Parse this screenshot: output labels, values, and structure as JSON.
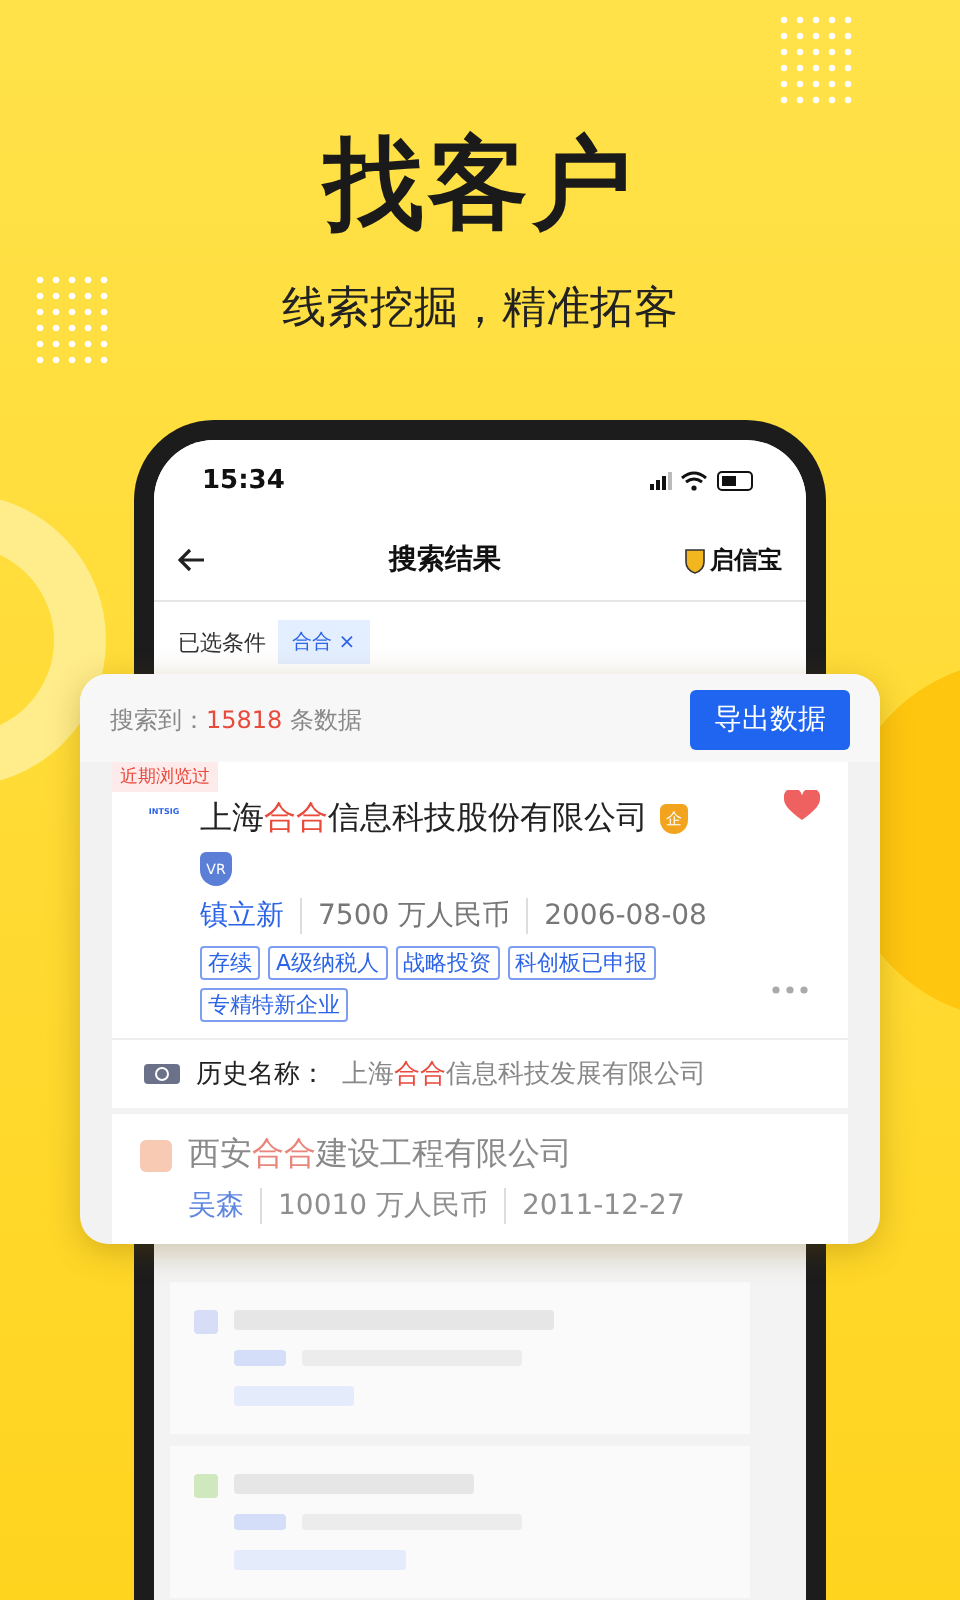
{
  "headline": "找客户",
  "subtitle": "线索挖掘，精准拓客",
  "status_bar": {
    "time": "15:34"
  },
  "nav": {
    "title": "搜索结果",
    "brand": "启信宝"
  },
  "filters": {
    "label": "已选条件",
    "chips": [
      {
        "text": "合合",
        "close": "×"
      }
    ]
  },
  "results": {
    "prefix": "搜索到：",
    "count": "15818",
    "suffix": "条数据",
    "export_button": "导出数据"
  },
  "featured": {
    "badge": "近期浏览过",
    "logo": "INTSIG",
    "name": [
      {
        "text": "上海",
        "hit": false
      },
      {
        "text": "合合",
        "hit": true
      },
      {
        "text": "信息科技股份有限公司",
        "hit": false
      }
    ],
    "enterprise_badge": "企",
    "vr_badge": "VR",
    "favorited": true,
    "person": "镇立新",
    "capital": "7500 万人民币",
    "date": "2006-08-08",
    "tags": [
      "存续",
      "A级纳税人",
      "战略投资",
      "科创板已申报",
      "专精特新企业"
    ],
    "history_label": "历史名称：",
    "history_name": [
      {
        "text": "上海",
        "hit": false
      },
      {
        "text": "合合",
        "hit": true
      },
      {
        "text": "信息科技发展有限公司",
        "hit": false
      }
    ]
  },
  "companies": [
    {
      "name": [
        {
          "text": "西安",
          "hit": false
        },
        {
          "text": "合合",
          "hit": true
        },
        {
          "text": "建设工程有限公司",
          "hit": false
        }
      ],
      "person": "吴森",
      "capital": "10010 万人民币",
      "date": "2011-12-27"
    }
  ]
}
